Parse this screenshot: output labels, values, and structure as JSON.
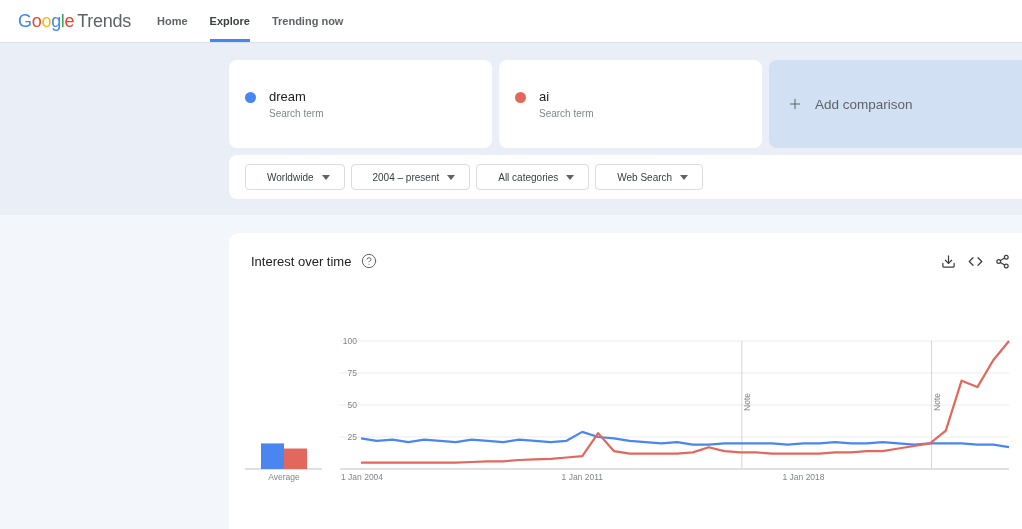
{
  "header": {
    "logo": {
      "brand": "Google",
      "product": "Trends"
    },
    "nav": [
      {
        "label": "Home",
        "selected": false
      },
      {
        "label": "Explore",
        "selected": true
      },
      {
        "label": "Trending now",
        "selected": false
      }
    ]
  },
  "terms": [
    {
      "term": "dream",
      "caption": "Search term",
      "color": "#4a86f0"
    },
    {
      "term": "ai",
      "caption": "Search term",
      "color": "#e2675d"
    }
  ],
  "add_comparison": {
    "label": "Add comparison"
  },
  "filters": [
    {
      "label": "Worldwide"
    },
    {
      "label": "2004 – present"
    },
    {
      "label": "All categories"
    },
    {
      "label": "Web Search"
    }
  ],
  "interest_over_time": {
    "title": "Interest over time",
    "average_chart": {
      "chart_data": {
        "type": "bar",
        "categories": [
          "Average"
        ],
        "ylim": [
          0,
          100
        ],
        "series": [
          {
            "color": "#4a86f0",
            "values": [
              20
            ]
          },
          {
            "color": "#e2675d",
            "values": [
              16
            ]
          }
        ]
      }
    },
    "chart_data": {
      "type": "line",
      "ylim": [
        0,
        100
      ],
      "yticks": [
        25,
        50,
        75,
        100
      ],
      "categories": [
        "1 Jan 2004",
        null,
        null,
        null,
        null,
        null,
        null,
        null,
        null,
        null,
        null,
        null,
        null,
        null,
        "1 Jan 2011",
        null,
        null,
        null,
        null,
        null,
        null,
        null,
        null,
        null,
        null,
        null,
        null,
        null,
        "1 Jan 2018",
        null,
        null,
        null,
        null,
        null,
        null,
        null,
        null,
        null,
        null,
        null,
        null,
        null
      ],
      "series": [
        {
          "color": "#4a86f0",
          "values": [
            24,
            22,
            23,
            21,
            23,
            22,
            21,
            23,
            22,
            21,
            23,
            22,
            21,
            22,
            29,
            25,
            24,
            22,
            21,
            20,
            21,
            19,
            19,
            20,
            20,
            20,
            20,
            19,
            20,
            20,
            21,
            20,
            20,
            21,
            20,
            19,
            20,
            20,
            20,
            19,
            19,
            17
          ]
        },
        {
          "color": "#e2675d",
          "values": [
            5,
            5,
            5,
            5,
            5,
            5,
            5,
            5.5,
            6,
            6,
            7,
            7.5,
            8,
            9,
            10,
            28,
            14,
            12,
            12,
            12,
            12,
            13,
            17,
            14,
            13,
            13,
            12,
            12,
            12,
            12,
            13,
            13,
            14,
            14,
            16,
            18,
            20,
            30,
            69,
            64,
            85,
            100
          ]
        }
      ],
      "grid": true,
      "annotations": [
        "Note",
        "Note"
      ]
    }
  }
}
